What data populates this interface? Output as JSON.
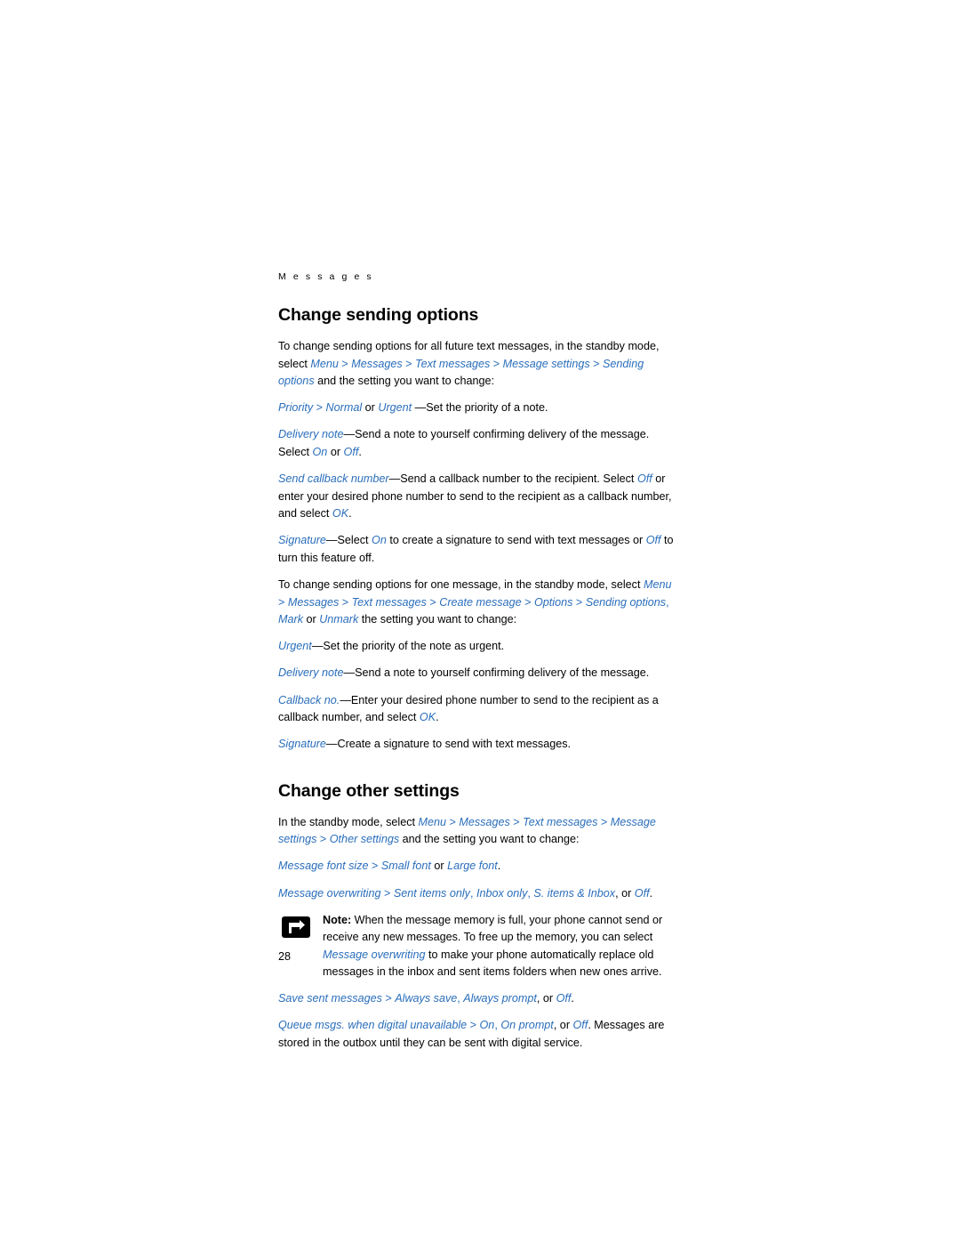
{
  "page": {
    "running_head": "M e s s a g e s",
    "folio": "28",
    "accent_color": "#2a6ebb"
  },
  "sections": [
    {
      "title": "Change sending options",
      "paragraphs": [
        [
          {
            "t": "To change sending options for all future text messages, in the standby mode, select ",
            "s": "plain"
          },
          {
            "t": "Menu",
            "s": "blue-i"
          },
          {
            "t": " > ",
            "s": "blue"
          },
          {
            "t": "Messages",
            "s": "blue-i"
          },
          {
            "t": " > ",
            "s": "blue"
          },
          {
            "t": "Text messages",
            "s": "blue-i"
          },
          {
            "t": " > ",
            "s": "blue"
          },
          {
            "t": "Message settings",
            "s": "blue-i"
          },
          {
            "t": " > ",
            "s": "blue"
          },
          {
            "t": "Sending options",
            "s": "blue-i"
          },
          {
            "t": " and the setting you want to change:",
            "s": "plain"
          }
        ],
        [
          {
            "t": "Priority",
            "s": "blue-i"
          },
          {
            "t": " > ",
            "s": "blue"
          },
          {
            "t": "Normal",
            "s": "blue-i"
          },
          {
            "t": " or ",
            "s": "plain"
          },
          {
            "t": "Urgent",
            "s": "blue-i"
          },
          {
            "t": " —Set the priority of a note.",
            "s": "plain"
          }
        ],
        [
          {
            "t": "Delivery note",
            "s": "blue-i"
          },
          {
            "t": "—Send a note to yourself confirming delivery of the message. Select ",
            "s": "plain"
          },
          {
            "t": "On",
            "s": "blue-i"
          },
          {
            "t": " or ",
            "s": "plain"
          },
          {
            "t": "Off",
            "s": "blue-i"
          },
          {
            "t": ".",
            "s": "plain"
          }
        ],
        [
          {
            "t": "Send callback number",
            "s": "blue-i"
          },
          {
            "t": "—Send a callback number to the recipient. Select ",
            "s": "plain"
          },
          {
            "t": "Off",
            "s": "blue-i"
          },
          {
            "t": " or enter your desired phone number to send to the recipient as a callback number, and select ",
            "s": "plain"
          },
          {
            "t": "OK",
            "s": "blue-i"
          },
          {
            "t": ".",
            "s": "plain"
          }
        ],
        [
          {
            "t": "Signature",
            "s": "blue-i"
          },
          {
            "t": "—Select ",
            "s": "plain"
          },
          {
            "t": "On",
            "s": "blue-i"
          },
          {
            "t": " to create a signature to send with text messages or ",
            "s": "plain"
          },
          {
            "t": "Off",
            "s": "blue-i"
          },
          {
            "t": " to turn this feature off.",
            "s": "plain"
          }
        ],
        [
          {
            "t": "To change sending options for one message, in the standby mode, select ",
            "s": "plain"
          },
          {
            "t": "Menu",
            "s": "blue-i"
          },
          {
            "t": " > ",
            "s": "blue"
          },
          {
            "t": "Messages",
            "s": "blue-i"
          },
          {
            "t": " > ",
            "s": "blue"
          },
          {
            "t": "Text messages",
            "s": "blue-i"
          },
          {
            "t": " > ",
            "s": "blue"
          },
          {
            "t": "Create message",
            "s": "blue-i"
          },
          {
            "t": " > ",
            "s": "blue"
          },
          {
            "t": "Options",
            "s": "blue-i"
          },
          {
            "t": " > ",
            "s": "blue"
          },
          {
            "t": "Sending options",
            "s": "blue-i"
          },
          {
            "t": ", ",
            "s": "blue"
          },
          {
            "t": "Mark",
            "s": "blue-i"
          },
          {
            "t": " or ",
            "s": "plain"
          },
          {
            "t": "Unmark",
            "s": "blue-i"
          },
          {
            "t": " the setting you want to change:",
            "s": "plain"
          }
        ],
        [
          {
            "t": "Urgent",
            "s": "blue-i"
          },
          {
            "t": "—Set the priority of the note as urgent.",
            "s": "plain"
          }
        ],
        [
          {
            "t": "Delivery note",
            "s": "blue-i"
          },
          {
            "t": "—Send a note to yourself confirming delivery of the message.",
            "s": "plain"
          }
        ],
        [
          {
            "t": "Callback no.",
            "s": "blue-i"
          },
          {
            "t": "—Enter your desired phone number to send to the recipient as a callback number, and select ",
            "s": "plain"
          },
          {
            "t": "OK",
            "s": "blue-i"
          },
          {
            "t": ".",
            "s": "plain"
          }
        ],
        [
          {
            "t": "Signature",
            "s": "blue-i"
          },
          {
            "t": "—Create a signature to send with text messages.",
            "s": "plain"
          }
        ]
      ]
    },
    {
      "title": "Change other settings",
      "paragraphs": [
        [
          {
            "t": "In the standby mode, select ",
            "s": "plain"
          },
          {
            "t": "Menu",
            "s": "blue-i"
          },
          {
            "t": " > ",
            "s": "blue"
          },
          {
            "t": "Messages",
            "s": "blue-i"
          },
          {
            "t": " > ",
            "s": "blue"
          },
          {
            "t": "Text messages",
            "s": "blue-i"
          },
          {
            "t": " > ",
            "s": "blue"
          },
          {
            "t": "Message settings",
            "s": "blue-i"
          },
          {
            "t": " > ",
            "s": "blue"
          },
          {
            "t": "Other settings",
            "s": "blue-i"
          },
          {
            "t": " and the setting you want to change:",
            "s": "plain"
          }
        ],
        [
          {
            "t": "Message font size",
            "s": "blue-i"
          },
          {
            "t": " > ",
            "s": "blue"
          },
          {
            "t": "Small font",
            "s": "blue-i"
          },
          {
            "t": " or ",
            "s": "plain"
          },
          {
            "t": "Large font",
            "s": "blue-i"
          },
          {
            "t": ".",
            "s": "plain"
          }
        ],
        [
          {
            "t": "Message overwriting",
            "s": "blue-i"
          },
          {
            "t": " > ",
            "s": "blue"
          },
          {
            "t": "Sent items only",
            "s": "blue-i"
          },
          {
            "t": ", ",
            "s": "blue"
          },
          {
            "t": "Inbox only",
            "s": "blue-i"
          },
          {
            "t": ", ",
            "s": "blue"
          },
          {
            "t": "S. items & Inbox",
            "s": "blue-i"
          },
          {
            "t": ", or ",
            "s": "plain"
          },
          {
            "t": "Off",
            "s": "blue-i"
          },
          {
            "t": ".",
            "s": "plain"
          }
        ]
      ]
    }
  ],
  "note": {
    "icon": "note-pointer-icon",
    "label": "Note:",
    "runs": [
      {
        "t": "Note:",
        "s": "bold"
      },
      {
        "t": " When the message memory is full, your phone cannot send or receive any new messages. To free up the memory, you can select ",
        "s": "plain"
      },
      {
        "t": "Message overwriting",
        "s": "blue-i"
      },
      {
        "t": " to make your phone automatically replace old messages in the inbox and sent items folders when new ones arrive.",
        "s": "plain"
      }
    ]
  },
  "trailing_paragraphs": [
    [
      {
        "t": "Save sent messages",
        "s": "blue-i"
      },
      {
        "t": " > ",
        "s": "blue"
      },
      {
        "t": "Always save",
        "s": "blue-i"
      },
      {
        "t": ", ",
        "s": "blue"
      },
      {
        "t": "Always prompt",
        "s": "blue-i"
      },
      {
        "t": ", or ",
        "s": "plain"
      },
      {
        "t": "Off",
        "s": "blue-i"
      },
      {
        "t": ".",
        "s": "plain"
      }
    ],
    [
      {
        "t": "Queue msgs. when digital unavailable",
        "s": "blue-i"
      },
      {
        "t": " > ",
        "s": "blue"
      },
      {
        "t": "On",
        "s": "blue-i"
      },
      {
        "t": ", ",
        "s": "blue"
      },
      {
        "t": "On prompt",
        "s": "blue-i"
      },
      {
        "t": ", or ",
        "s": "plain"
      },
      {
        "t": "Off",
        "s": "blue-i"
      },
      {
        "t": ". Messages are stored in the outbox until they can be sent with digital service.",
        "s": "plain"
      }
    ]
  ]
}
